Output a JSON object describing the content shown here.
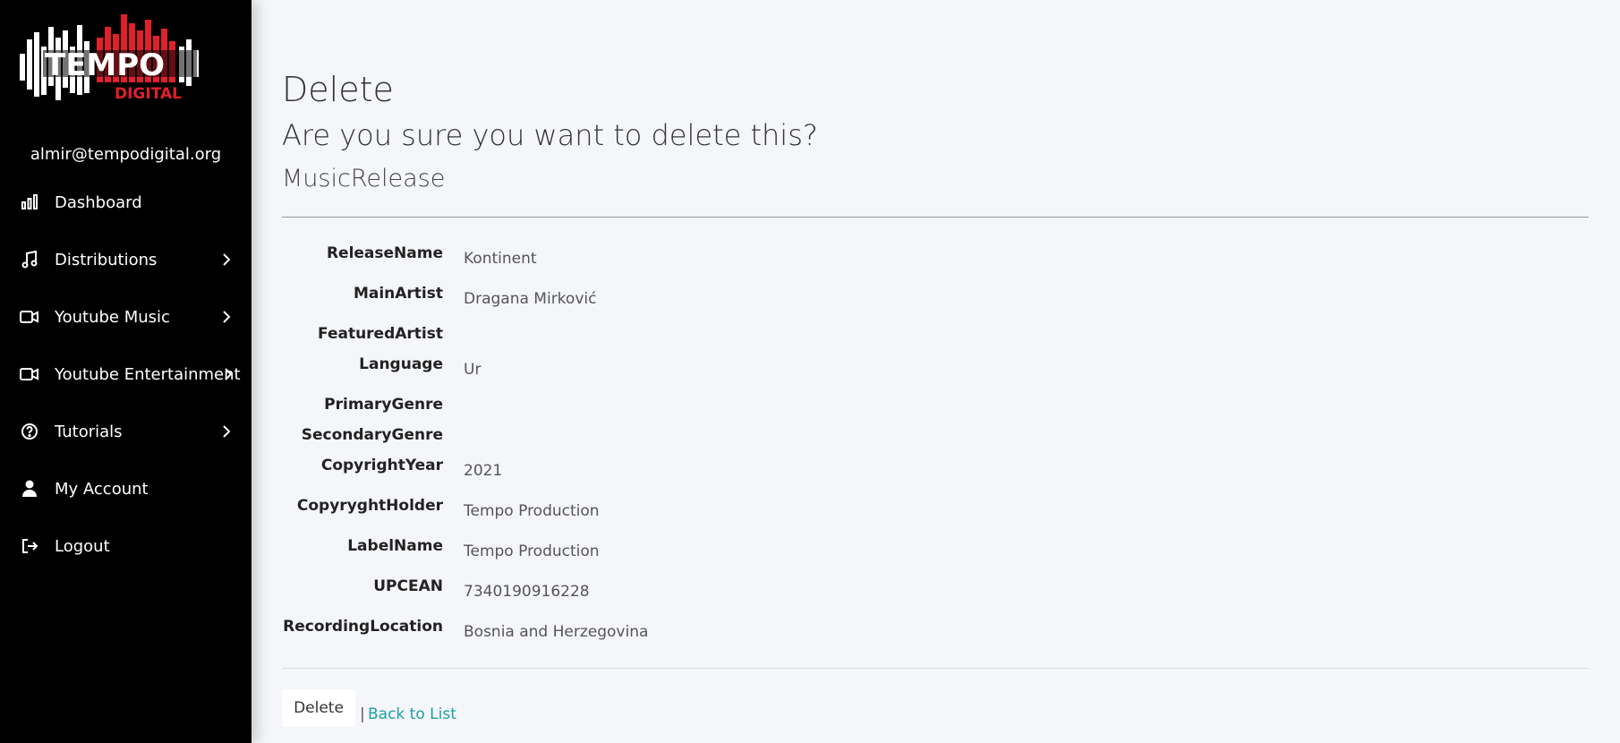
{
  "app": {
    "logo": {
      "icon": "tempo-digital-logo",
      "word": "TEMPO",
      "subword": "DIGITAL"
    },
    "user_email": "almir@tempodigital.org"
  },
  "sidebar": {
    "items": [
      {
        "label": "Dashboard",
        "icon": "bar-chart-icon",
        "has_submenu": false
      },
      {
        "label": "Distributions",
        "icon": "music-note-icon",
        "has_submenu": true
      },
      {
        "label": "Youtube Music",
        "icon": "video-camera-icon",
        "has_submenu": true
      },
      {
        "label": "Youtube Entertainment",
        "icon": "video-camera-icon",
        "has_submenu": true
      },
      {
        "label": "Tutorials",
        "icon": "question-circle-icon",
        "has_submenu": true
      },
      {
        "label": "My Account",
        "icon": "user-icon",
        "has_submenu": false
      },
      {
        "label": "Logout",
        "icon": "sign-out-icon",
        "has_submenu": false
      }
    ]
  },
  "page": {
    "title": "Delete",
    "confirm_question": "Are you sure you want to delete this?",
    "entity_name": "MusicRelease"
  },
  "details": [
    {
      "label": "ReleaseName",
      "value": "Kontinent"
    },
    {
      "label": "MainArtist",
      "value": "Dragana Mirković"
    },
    {
      "label": "FeaturedArtist",
      "value": ""
    },
    {
      "label": "Language",
      "value": "Ur"
    },
    {
      "label": "PrimaryGenre",
      "value": ""
    },
    {
      "label": "SecondaryGenre",
      "value": ""
    },
    {
      "label": "CopyrightYear",
      "value": "2021"
    },
    {
      "label": "CopyryghtHolder",
      "value": "Tempo Production"
    },
    {
      "label": "LabelName",
      "value": "Tempo Production"
    },
    {
      "label": "UPCEAN",
      "value": "7340190916228"
    },
    {
      "label": "RecordingLocation",
      "value": "Bosnia and Herzegovina"
    }
  ],
  "actions": {
    "delete_label": "Delete",
    "separator": "|",
    "back_label": "Back to List"
  },
  "colors": {
    "sidebar_bg": "#000000",
    "page_bg": "#f5f6fa",
    "brand_red": "#e0202a",
    "link": "#1aa0a6"
  }
}
